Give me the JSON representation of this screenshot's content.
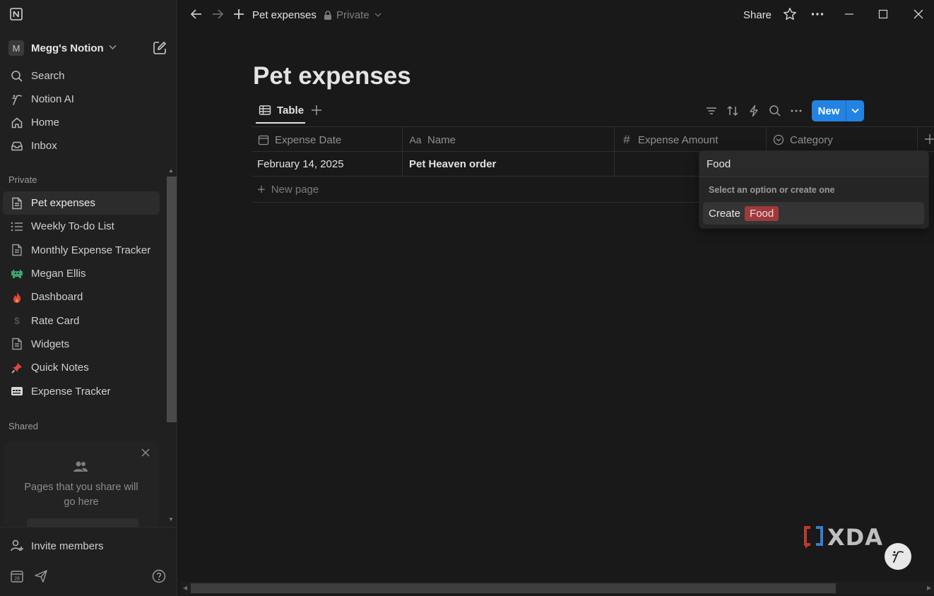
{
  "sidebar": {
    "workspace": {
      "avatar_letter": "M",
      "name": "Megg's Notion"
    },
    "nav": [
      {
        "label": "Search",
        "icon": "search-icon"
      },
      {
        "label": "Notion AI",
        "icon": "notion-ai-icon"
      },
      {
        "label": "Home",
        "icon": "home-icon"
      },
      {
        "label": "Inbox",
        "icon": "inbox-icon"
      }
    ],
    "private_label": "Private",
    "pages": [
      {
        "label": "Pet expenses",
        "icon": "page-icon",
        "active": true
      },
      {
        "label": "Weekly To-do List",
        "icon": "list-icon"
      },
      {
        "label": "Monthly Expense Tracker",
        "icon": "page-icon"
      },
      {
        "label": "Megan Ellis",
        "icon": "space-invader-icon"
      },
      {
        "label": "Dashboard",
        "icon": "fire-icon"
      },
      {
        "label": "Rate Card",
        "icon": "dollar-icon"
      },
      {
        "label": "Widgets",
        "icon": "page-icon"
      },
      {
        "label": "Quick Notes",
        "icon": "pushpin-icon"
      },
      {
        "label": "Expense Tracker",
        "icon": "card-icon"
      }
    ],
    "shared_label": "Shared",
    "shared_empty_text": "Pages that you share will go here",
    "invite_label": "Invite members"
  },
  "topbar": {
    "breadcrumb_title": "Pet expenses",
    "privacy": "Private",
    "share_label": "Share"
  },
  "page": {
    "title": "Pet expenses",
    "view_tab": "Table",
    "new_button": "New"
  },
  "table": {
    "columns": [
      {
        "label": "Expense Date",
        "icon": "calendar-icon"
      },
      {
        "label": "Name",
        "icon": "text-aa-icon"
      },
      {
        "label": "Expense Amount",
        "icon": "hash-icon"
      },
      {
        "label": "Category",
        "icon": "select-icon"
      }
    ],
    "rows": [
      {
        "date": "February 14, 2025",
        "name": "Pet Heaven order",
        "amount": "",
        "category": ""
      }
    ],
    "new_page_label": "New page"
  },
  "category_dropdown": {
    "input_value": "Food",
    "hint": "Select an option or create one",
    "create_label": "Create",
    "create_tag": "Food",
    "tag_color": "#9f3a3c"
  },
  "watermark": {
    "text": "XDA"
  },
  "colors": {
    "accent": "#2383e2",
    "background": "#191919",
    "sidebar": "#202020"
  }
}
